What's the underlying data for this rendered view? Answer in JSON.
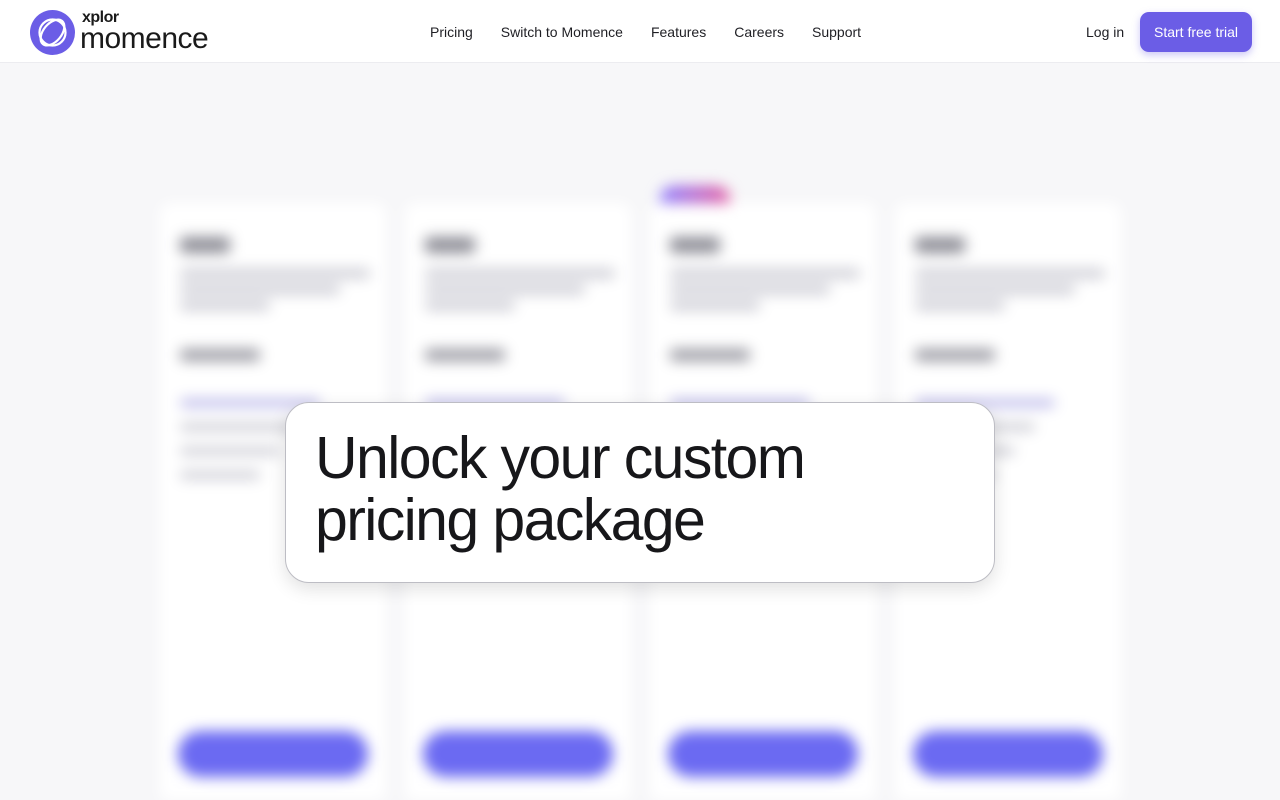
{
  "header": {
    "logo": {
      "sub": "xplor",
      "main": "momence",
      "icon": "momence-logo-icon",
      "color": "#6b5de6"
    },
    "nav": [
      {
        "label": "Pricing"
      },
      {
        "label": "Switch to Momence"
      },
      {
        "label": "Features"
      },
      {
        "label": "Careers"
      },
      {
        "label": "Support"
      }
    ],
    "login_label": "Log in",
    "cta_label": "Start free trial"
  },
  "modal": {
    "title": "Unlock your custom pricing package"
  },
  "colors": {
    "accent": "#6b5de6",
    "background": "#f7f7f9"
  }
}
